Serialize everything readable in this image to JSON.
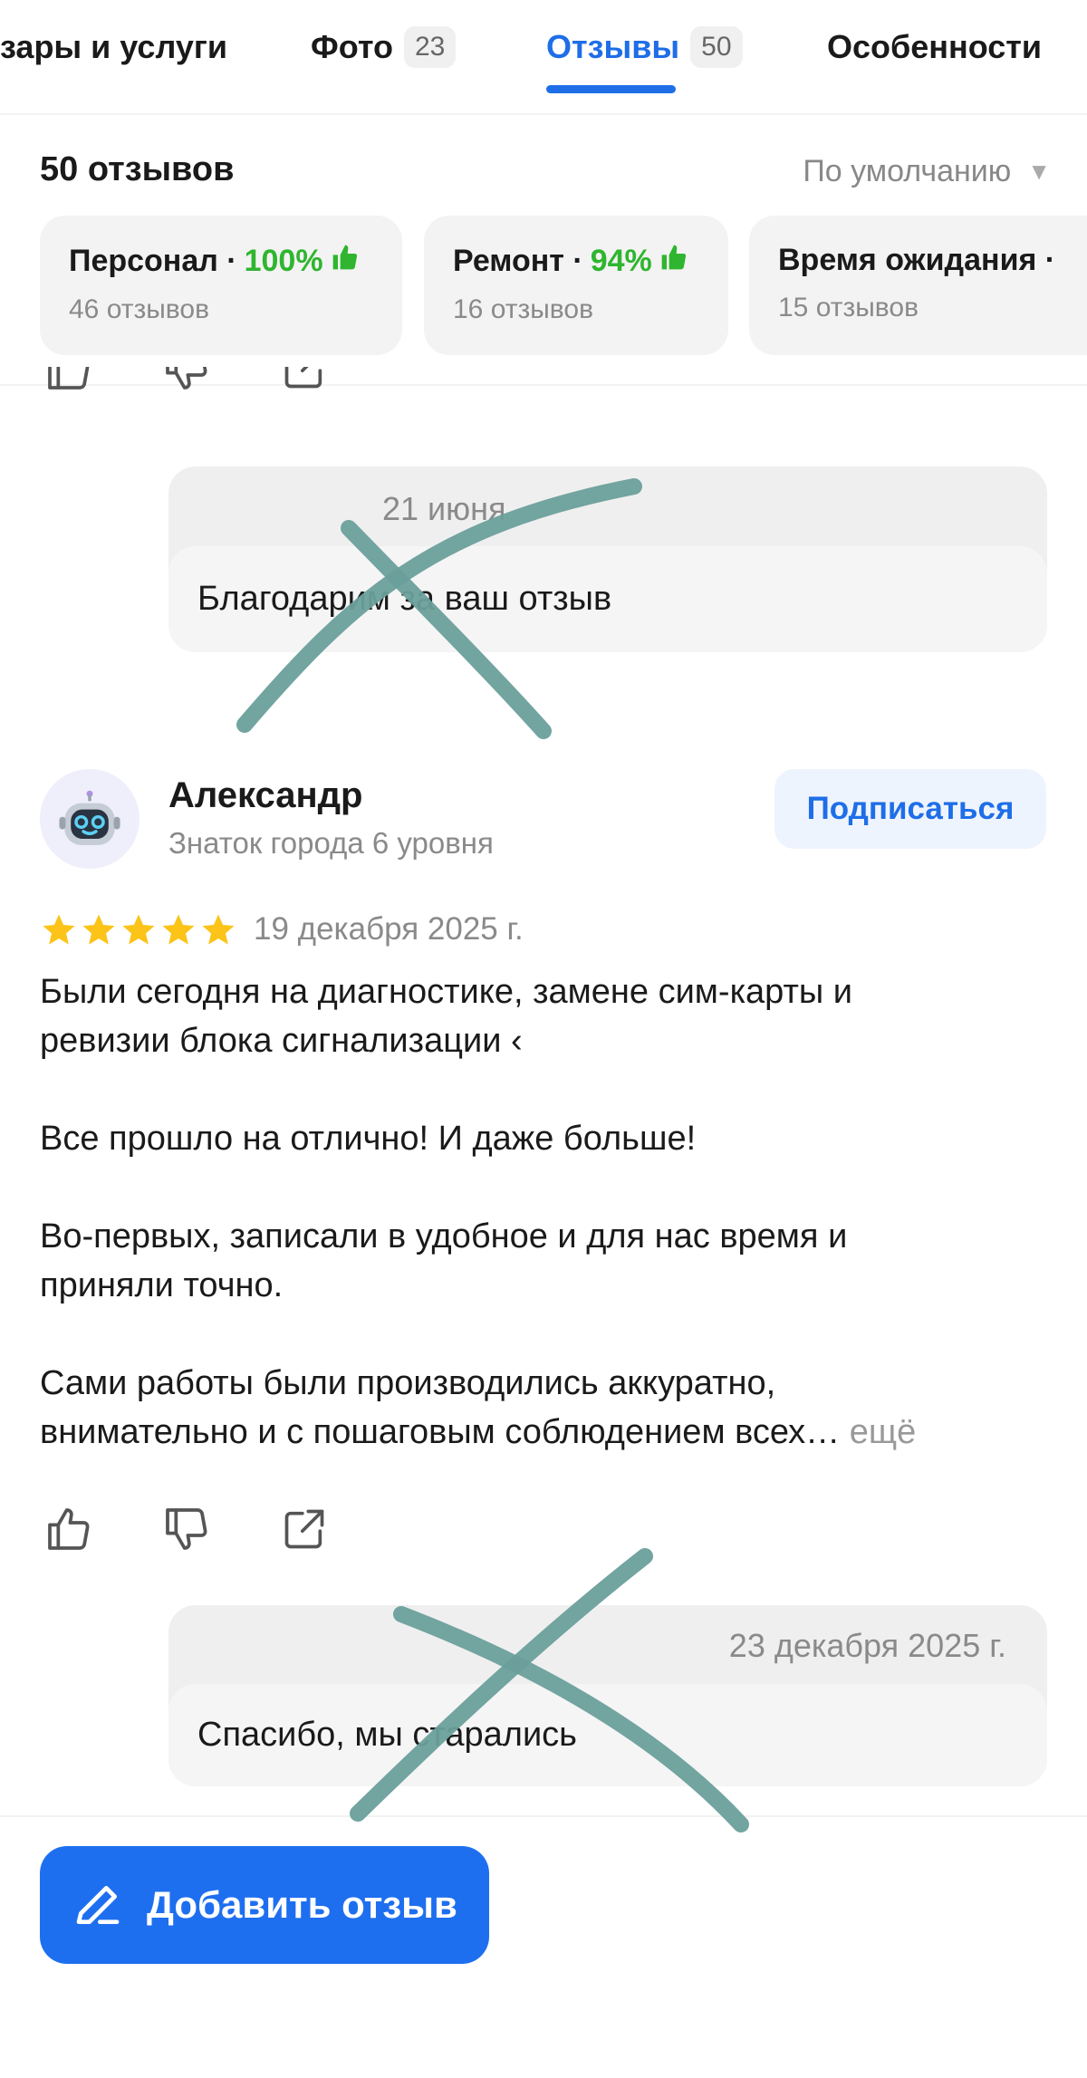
{
  "tabs": [
    {
      "label": "зары и услуги",
      "count": ""
    },
    {
      "label": "Фото",
      "count": "23"
    },
    {
      "label": "Отзывы",
      "count": "50"
    },
    {
      "label": "Особенности",
      "count": ""
    }
  ],
  "reviews_header": {
    "title": "50 отзывов",
    "sort": "По умолчанию"
  },
  "aspects": [
    {
      "name": "Персонал · ",
      "percent": "100%",
      "count": "46 отзывов"
    },
    {
      "name": "Ремонт · ",
      "percent": "94%",
      "count": "16 отзывов"
    },
    {
      "name": "Время ожидания · ",
      "percent": "",
      "count": "15 отзывов"
    }
  ],
  "prev_reply": {
    "date": "21 июня",
    "text": "Благодарим за ваш отзыв"
  },
  "review": {
    "author": "Александр",
    "level": "Знаток города 6 уровня",
    "subscribe_label": "Подписаться",
    "rating": 5,
    "date": "19 декабря 2025 г.",
    "lines": [
      "Были сегодня на диагностике, замене сим-карты и",
      "ревизии блока сигнализации ‹",
      "Все прошло на отлично! И даже больше!",
      "Во-первых, записали в удобное и для нас время и",
      "приняли точно.",
      "Сами работы были производились аккуратно,",
      "внимательно и с пошаговым соблюдением всех… "
    ],
    "more_label": "ещё",
    "reply_date": "23 декабря 2025 г.",
    "reply_text": "Спасибо, мы старались"
  },
  "add_review_label": "Добавить отзыв",
  "colors": {
    "accent": "#1e6ee8",
    "positive": "#2fb52f",
    "star": "#fcc419",
    "annotation": "#6a9f9b"
  }
}
